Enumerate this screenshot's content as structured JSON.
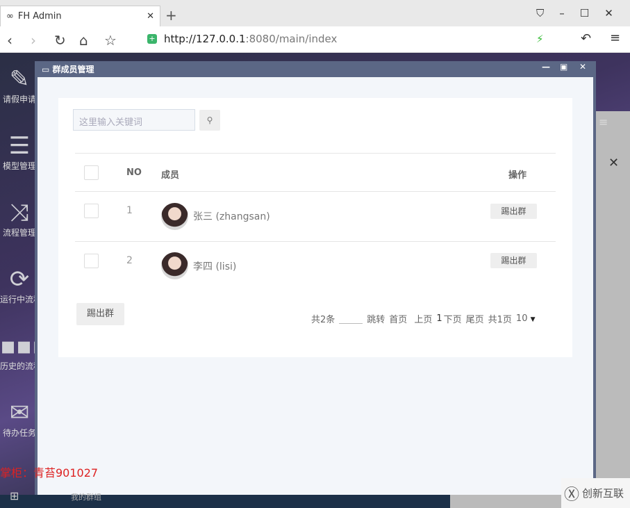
{
  "browser": {
    "tab_title": "FH Admin",
    "url_host": "http://127.0.0.1",
    "url_rest": ":8080/main/index"
  },
  "sidebar": [
    {
      "label": "请假申请",
      "icon": "edit-icon"
    },
    {
      "label": "模型管理",
      "icon": "list-icon"
    },
    {
      "label": "流程管理",
      "icon": "shuffle-icon"
    },
    {
      "label": "运行中流程",
      "icon": "refresh-icon"
    },
    {
      "label": "历史的流程",
      "icon": "ellipsis-icon"
    },
    {
      "label": "待办任务",
      "icon": "envelope-icon"
    }
  ],
  "window": {
    "title": "群成员管理"
  },
  "search": {
    "placeholder": "这里输入关键词"
  },
  "table": {
    "headers": {
      "no": "NO",
      "member": "成员",
      "action": "操作"
    },
    "rows": [
      {
        "no": "1",
        "member": "张三 (zhangsan)",
        "action": "踢出群"
      },
      {
        "no": "2",
        "member": "李四 (lisi)",
        "action": "踢出群"
      }
    ]
  },
  "bulk_kick": "踢出群",
  "pager": {
    "total": "共2条",
    "jump": "跳转",
    "first": "首页",
    "prev": "上页",
    "current": "1",
    "next": "下页",
    "last": "尾页",
    "pages": "共1页",
    "size": "10"
  },
  "taskbar": {
    "item": "我的群组"
  },
  "overlay": {
    "owner": "掌柜：青苔901027",
    "logo": "创新互联"
  }
}
